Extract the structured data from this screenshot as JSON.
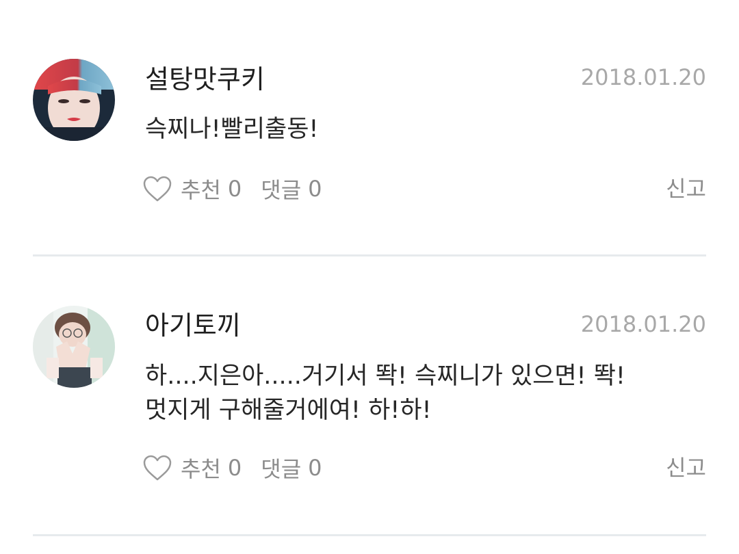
{
  "comments": [
    {
      "username": "설탕맛쿠키",
      "date": "2018.01.20",
      "text_lines": [
        "슥찌나!빨리출동!"
      ],
      "like_label": "추천",
      "like_count": "0",
      "reply_label": "댓글",
      "reply_count": "0",
      "report_label": "신고",
      "avatar_icon": "user-avatar-photo"
    },
    {
      "username": "아기토끼",
      "date": "2018.01.20",
      "text_lines": [
        "하....지은아.....거기서 똭! 슥찌니가 있으면! 똭!",
        "멋지게 구해줄거에여! 하!하!"
      ],
      "like_label": "추천",
      "like_count": "0",
      "reply_label": "댓글",
      "reply_count": "0",
      "report_label": "신고",
      "avatar_icon": "user-avatar-photo"
    }
  ],
  "colors": {
    "divider": "#e6eaed",
    "muted_text": "#8c8c8c",
    "date_text": "#a8a8a8"
  }
}
